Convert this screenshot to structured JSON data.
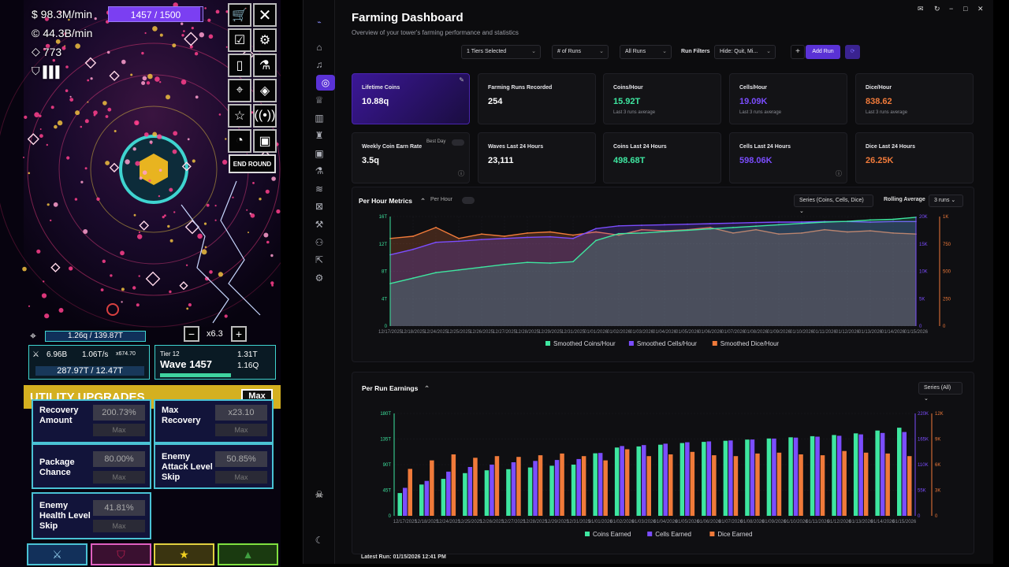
{
  "game": {
    "money_rate": "$ 98.3M/min",
    "coin_rate": "44.3B/min",
    "gems": "773",
    "wave_progress_text": "1457 / 1500",
    "wave_progress_fraction": 0.971,
    "end_round_label": "END ROUND",
    "health_text": "1.26q / 139.87T",
    "speed_multiplier": "x6.3",
    "damage": "6.96B",
    "regen": "1.06T/s",
    "coin_mult": "x674.70",
    "shield_text": "287.97T / 12.47T",
    "tier": "Tier 12",
    "wave": "Wave 1457",
    "tier_stat_1": "1.31T",
    "tier_stat_2": "1.16Q",
    "upgrades_title": "UTILITY UPGRADES",
    "max_button": "Max",
    "upgrades": [
      {
        "label": "Recovery Amount",
        "value": "200.73%",
        "max": "Max"
      },
      {
        "label": "Max Recovery",
        "value": "x23.10",
        "max": "Max"
      },
      {
        "label": "Package Chance",
        "value": "80.00%",
        "max": "Max"
      },
      {
        "label": "Enemy Attack Level Skip",
        "value": "50.85%",
        "max": "Max"
      },
      {
        "label": "Enemy Health Level Skip",
        "value": "41.81%",
        "max": "Max"
      }
    ]
  },
  "app": {
    "title": "Farming Dashboard",
    "subtitle": "Overview of your tower's farming performance and statistics",
    "filters": {
      "tiers": "1 Tiers Selected",
      "runs": "# of Runs",
      "all_runs": "All Runs",
      "run_filters_label": "Run Filters",
      "hide": "Hide: Quit, Mi...",
      "add_run": "Add Run",
      "plus": "+"
    },
    "cards": [
      {
        "label": "Lifetime Coins",
        "value": "10.88q",
        "sub": "",
        "color": "#ffffff"
      },
      {
        "label": "Farming Runs Recorded",
        "value": "254",
        "sub": "",
        "color": "#ffffff"
      },
      {
        "label": "Coins/Hour",
        "value": "15.92T",
        "sub": "Last 3 runs average",
        "color": "#3ee6a0"
      },
      {
        "label": "Cells/Hour",
        "value": "19.09K",
        "sub": "Last 3 runs average",
        "color": "#7b4dff"
      },
      {
        "label": "Dice/Hour",
        "value": "838.62",
        "sub": "Last 3 runs average",
        "color": "#f07a3a"
      },
      {
        "label": "Weekly Coin Earn Rate",
        "value": "3.5q",
        "sub": "",
        "color": "#ffffff",
        "badge": "Best Day"
      },
      {
        "label": "Waves Last 24 Hours",
        "value": "23,111",
        "sub": "",
        "color": "#ffffff"
      },
      {
        "label": "Coins Last 24 Hours",
        "value": "498.68T",
        "sub": "",
        "color": "#3ee6a0"
      },
      {
        "label": "Cells Last 24 Hours",
        "value": "598.06K",
        "sub": "",
        "color": "#7b4dff"
      },
      {
        "label": "Dice Last 24 Hours",
        "value": "26.25K",
        "sub": "",
        "color": "#f07a3a"
      }
    ],
    "per_hour": {
      "title": "Per Hour Metrics",
      "toggle_label": "Per Hour",
      "series_select": "Series (Coins, Cells, Dice)",
      "rolling_label": "Rolling Average",
      "rolling_select": "3 runs"
    },
    "per_run": {
      "title": "Per Run Earnings",
      "series_select": "Series (All)"
    },
    "latest_run": "Latest Run: 01/15/2026 12:41 PM",
    "colors": {
      "coins": "#3ee6a0",
      "cells": "#7b4dff",
      "dice": "#f07a3a",
      "accent": "#5a32d6"
    }
  },
  "chart_data": [
    {
      "type": "area",
      "title": "Per Hour Metrics",
      "x": [
        "12/17/2025",
        "12/18/2025",
        "12/24/2025",
        "12/25/2025",
        "12/26/2025",
        "12/27/2025",
        "12/28/2025",
        "12/29/2025",
        "12/31/2025",
        "01/01/2026",
        "01/02/2026",
        "01/03/2026",
        "01/04/2026",
        "01/05/2026",
        "01/06/2026",
        "01/07/2026",
        "01/08/2026",
        "01/09/2026",
        "01/10/2026",
        "01/11/2026",
        "01/12/2026",
        "01/13/2026",
        "01/14/2026",
        "01/15/2026"
      ],
      "axes": {
        "left": {
          "ticks": [
            "0",
            "4T",
            "8T",
            "12T",
            "16T"
          ],
          "range": [
            0,
            16
          ]
        },
        "right1": {
          "ticks": [
            "0",
            "5K",
            "10K",
            "15K",
            "20K"
          ],
          "range": [
            0,
            20
          ]
        },
        "right2": {
          "ticks": [
            "0",
            "250",
            "500",
            "750",
            "1K"
          ],
          "range": [
            0,
            1000
          ]
        }
      },
      "series": [
        {
          "name": "Smoothed Coins/Hour",
          "unit": "T",
          "values": [
            6.2,
            7.0,
            7.8,
            8.2,
            8.6,
            9.0,
            9.3,
            9.2,
            9.4,
            12.5,
            13.5,
            13.6,
            13.8,
            14.0,
            14.2,
            14.4,
            14.6,
            14.8,
            15.0,
            15.2,
            15.3,
            15.5,
            15.6,
            15.9
          ]
        },
        {
          "name": "Smoothed Cells/Hour",
          "unit": "K",
          "values": [
            13.0,
            14.0,
            15.3,
            15.5,
            15.8,
            16.0,
            16.2,
            16.3,
            16.0,
            17.8,
            18.3,
            18.4,
            18.5,
            18.6,
            18.7,
            18.8,
            18.9,
            19.0,
            19.0,
            19.1,
            19.1,
            19.0,
            19.1,
            19.1
          ]
        },
        {
          "name": "Smoothed Dice/Hour",
          "unit": "",
          "values": [
            800,
            820,
            900,
            800,
            840,
            820,
            850,
            860,
            830,
            860,
            830,
            880,
            870,
            880,
            900,
            850,
            880,
            840,
            850,
            880,
            860,
            870,
            850,
            840
          ]
        }
      ]
    },
    {
      "type": "bar",
      "title": "Per Run Earnings",
      "x": [
        "12/17/2025",
        "12/18/2025",
        "12/24/2025",
        "12/25/2025",
        "12/26/2025",
        "12/27/2025",
        "12/28/2025",
        "12/29/2025",
        "12/31/2025",
        "01/01/2026",
        "01/02/2026",
        "01/03/2026",
        "01/04/2026",
        "01/05/2026",
        "01/06/2026",
        "01/07/2026",
        "01/08/2026",
        "01/09/2026",
        "01/10/2026",
        "01/11/2026",
        "01/12/2026",
        "01/13/2026",
        "01/14/2026",
        "01/15/2026"
      ],
      "axes": {
        "left": {
          "ticks": [
            "0",
            "45T",
            "90T",
            "135T",
            "180T"
          ],
          "range": [
            0,
            180
          ]
        },
        "right1": {
          "ticks": [
            "0",
            "55K",
            "110K",
            "165K",
            "220K"
          ],
          "range": [
            0,
            220
          ]
        },
        "right2": {
          "ticks": [
            "0",
            "3K",
            "6K",
            "9K",
            "12K"
          ],
          "range": [
            0,
            12
          ]
        }
      },
      "series": [
        {
          "name": "Coins Earned",
          "unit": "T",
          "values": [
            40,
            55,
            65,
            75,
            80,
            82,
            85,
            88,
            90,
            110,
            120,
            122,
            125,
            128,
            130,
            132,
            134,
            136,
            138,
            140,
            142,
            145,
            150,
            155
          ]
        },
        {
          "name": "Cells Earned",
          "unit": "K",
          "values": [
            60,
            75,
            95,
            105,
            110,
            115,
            118,
            120,
            122,
            135,
            150,
            152,
            155,
            158,
            160,
            162,
            164,
            166,
            168,
            170,
            172,
            175,
            178,
            180
          ]
        },
        {
          "name": "Dice Earned",
          "unit": "K",
          "values": [
            5.5,
            6.5,
            7.2,
            6.8,
            7.0,
            6.9,
            7.1,
            7.3,
            7.0,
            6.5,
            7.8,
            7.0,
            7.2,
            7.5,
            7.1,
            7.0,
            7.3,
            7.4,
            7.2,
            7.1,
            7.6,
            7.4,
            7.3,
            7.0
          ]
        }
      ],
      "legend": [
        "Coins Earned",
        "Cells Earned",
        "Dice Earned"
      ]
    }
  ]
}
